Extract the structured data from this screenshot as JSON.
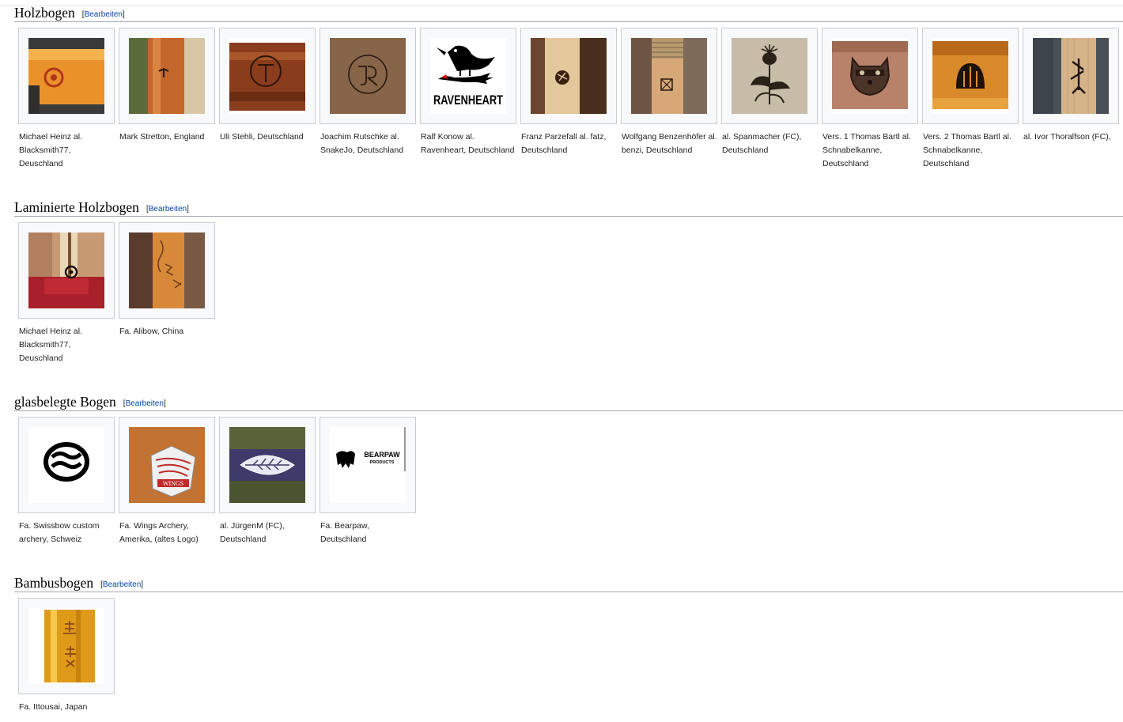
{
  "edit_label": "Bearbeiten",
  "sections": [
    {
      "title": "Holzbogen",
      "items": [
        {
          "caption": "Michael Heinz al. Blacksmith77, Deuschland",
          "image": "orange-wood-circle-mark"
        },
        {
          "caption": "Mark Stretton, England",
          "image": "wood-limb-mark"
        },
        {
          "caption": "Uli Stehli, Deutschland",
          "image": "wood-circle-cross-mark"
        },
        {
          "caption": "Joachim Rutschke al. SnakeJo, Deutschland",
          "image": "wood-JR-brand"
        },
        {
          "caption": "Ralf Konow al. Ravenheart, Deutschland",
          "image": "ravenheart-logo"
        },
        {
          "caption": "Franz Parzefall al. fatz, Deutschland",
          "image": "wood-bow-dark-mark"
        },
        {
          "caption": "Wolfgang Benzenhöfer al. benzi, Deutschland",
          "image": "wood-string-wrap-mark"
        },
        {
          "caption": "al. Spanmacher (FC), Deutschland",
          "image": "thistle-brand"
        },
        {
          "caption": "Vers. 1 Thomas Bartl al. Schnabelkanne, Deutschland",
          "image": "raccoon-brand"
        },
        {
          "caption": "Vers. 2 Thomas Bartl al. Schnabelkanne, Deutschland",
          "image": "wood-arch-brand"
        },
        {
          "caption": "al. Ivor Thoralfson (FC),",
          "image": "rune-mark"
        }
      ]
    },
    {
      "title": "Laminierte Holzbogen",
      "items": [
        {
          "caption": "Michael Heinz al. Blacksmith77, Deuschland",
          "image": "laminated-bow-red-grip"
        },
        {
          "caption": "Fa. Alibow, China",
          "image": "alibow-carving"
        }
      ]
    },
    {
      "title": "glasbelegte Bogen",
      "items": [
        {
          "caption": "Fa. Swissbow custom archery, Schweiz",
          "image": "swissbow-logo"
        },
        {
          "caption": "Fa. Wings Archery, Amerika, (altes Logo)",
          "image": "wings-logo"
        },
        {
          "caption": "al. JürgenM (FC), Deutschland",
          "image": "leaf-logo"
        },
        {
          "caption": "Fa. Bearpaw, Deutschland",
          "image": "bearpaw-logo",
          "logo_text": "BEARPAW",
          "logo_sub": "PRODUCTS"
        }
      ]
    },
    {
      "title": "Bambusbogen",
      "items": [
        {
          "caption": "Fa. Ittousai, Japan",
          "image": "bamboo-kanji"
        }
      ]
    }
  ]
}
